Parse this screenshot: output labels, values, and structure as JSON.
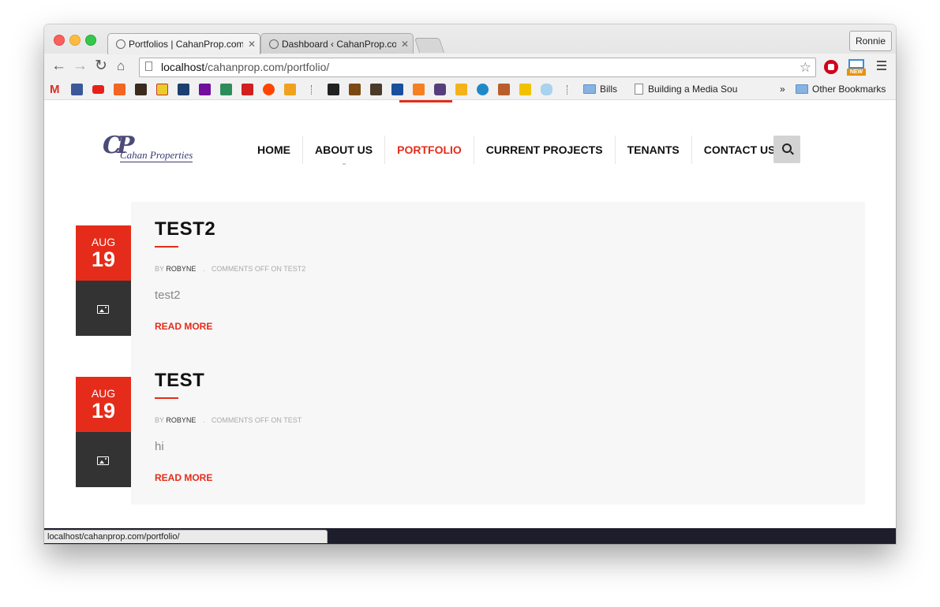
{
  "browser": {
    "tabs": [
      {
        "title": "Portfolios | CahanProp.com"
      },
      {
        "title": "Dashboard ‹ CahanProp.com"
      }
    ],
    "profile": "Ronnie",
    "url_host": "localhost",
    "url_path": "/cahanprop.com/portfolio/",
    "bookmarks": {
      "bills": "Bills",
      "media": "Building a Media Sou",
      "overflow": "»",
      "other": "Other Bookmarks"
    },
    "ext_badge": "NEW",
    "status_url": "localhost/cahanprop.com/portfolio/"
  },
  "site": {
    "logo_mark": "CP",
    "logo_text": "Cahan Properties",
    "nav": [
      "HOME",
      "ABOUT US",
      "PORTFOLIO",
      "CURRENT PROJECTS",
      "TENANTS",
      "CONTACT US"
    ],
    "active_nav": "PORTFOLIO"
  },
  "posts": [
    {
      "month": "AUG",
      "day": "19",
      "title": "TEST2",
      "by": "BY",
      "author": "ROBYNE",
      "comments": "COMMENTS OFF ON TEST2",
      "excerpt": "test2",
      "read_more": "READ MORE"
    },
    {
      "month": "AUG",
      "day": "19",
      "title": "TEST",
      "by": "BY",
      "author": "ROBYNE",
      "comments": "COMMENTS OFF ON TEST",
      "excerpt": "hi",
      "read_more": "READ MORE"
    }
  ],
  "colors": {
    "accent": "#e52c1a",
    "dark": "#333333",
    "footer": "#1e1d2b"
  }
}
